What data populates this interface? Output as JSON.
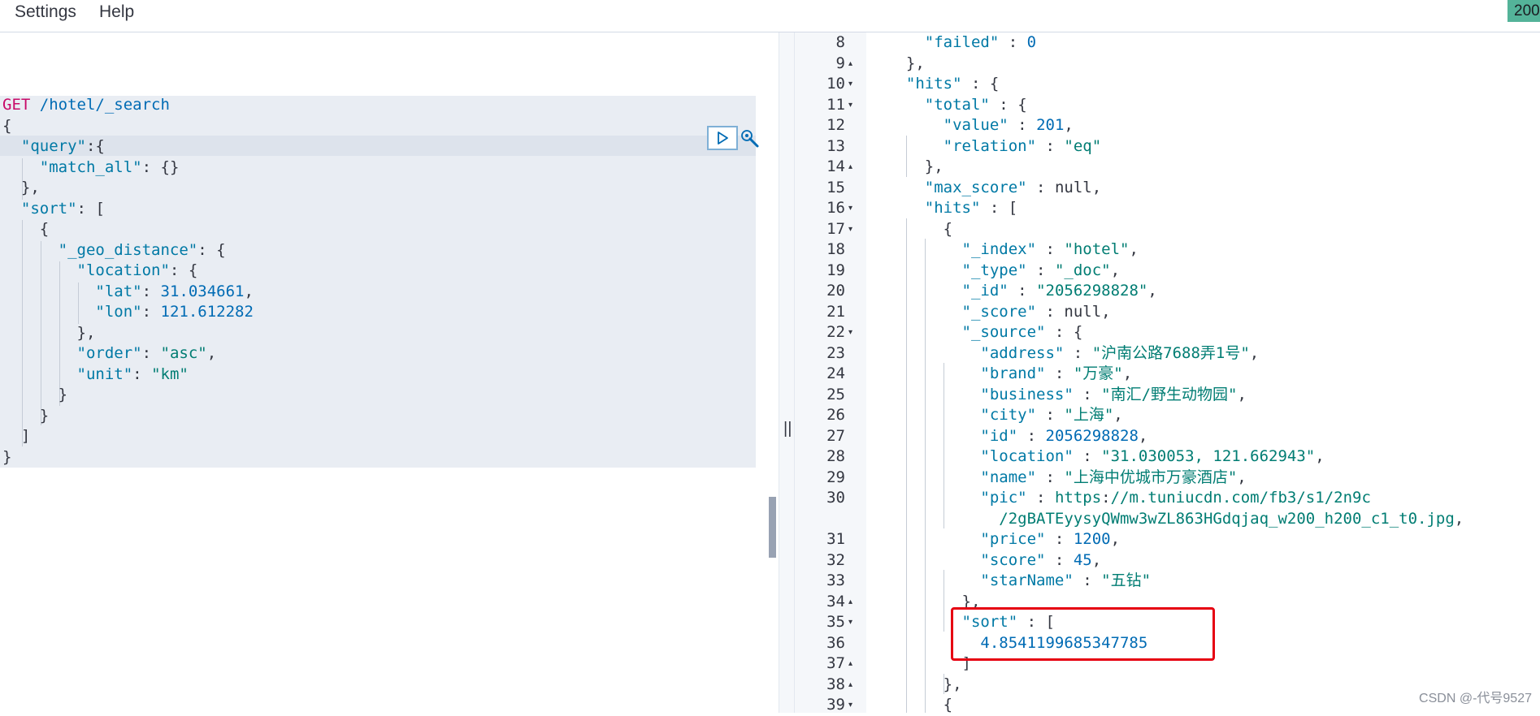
{
  "menu": {
    "settings_label": "Settings",
    "help_label": "Help"
  },
  "status_badge": "200",
  "request": {
    "method": "GET",
    "path": "/hotel/_search",
    "lines": [
      "{",
      "  \"query\":{",
      "    \"match_all\": {}",
      "  },",
      "  \"sort\": [",
      "    {",
      "      \"_geo_distance\": {",
      "        \"location\": {",
      "          \"lat\": 31.034661,",
      "          \"lon\": 121.612282",
      "        },",
      "        \"order\": \"asc\",",
      "        \"unit\": \"km\"",
      "      }",
      "    }",
      "  ]",
      "}"
    ]
  },
  "response": {
    "line_numbers": [
      "8",
      "9",
      "10",
      "11",
      "12",
      "13",
      "14",
      "15",
      "16",
      "17",
      "18",
      "19",
      "20",
      "21",
      "22",
      "23",
      "24",
      "25",
      "26",
      "27",
      "28",
      "29",
      "30",
      "",
      "31",
      "32",
      "33",
      "34",
      "35",
      "36",
      "37",
      "38",
      "39"
    ],
    "lines": [
      "    \"failed\" : 0",
      "  },",
      "  \"hits\" : {",
      "    \"total\" : {",
      "      \"value\" : 201,",
      "      \"relation\" : \"eq\"",
      "    },",
      "    \"max_score\" : null,",
      "    \"hits\" : [",
      "      {",
      "        \"_index\" : \"hotel\",",
      "        \"_type\" : \"_doc\",",
      "        \"_id\" : \"2056298828\",",
      "        \"_score\" : null,",
      "        \"_source\" : {",
      "          \"address\" : \"沪南公路7688弄1号\",",
      "          \"brand\" : \"万豪\",",
      "          \"business\" : \"南汇/野生动物园\",",
      "          \"city\" : \"上海\",",
      "          \"id\" : 2056298828,",
      "          \"location\" : \"31.030053, 121.662943\",",
      "          \"name\" : \"上海中优城市万豪酒店\",",
      "          \"pic\" : \"https://m.tuniucdn.com/fb3/s1/2n9c",
      "            /2gBATEyysyQWmw3wZL863HGdqjaq_w200_h200_c1_t0.jpg\",",
      "          \"price\" : 1200,",
      "          \"score\" : 45,",
      "          \"starName\" : \"五钻\"",
      "        },",
      "        \"sort\" : [",
      "          4.8541199685347785",
      "        ]",
      "      },",
      "      {"
    ],
    "folds": [
      "",
      "▴",
      "▾",
      "▾",
      "",
      "",
      "▴",
      "",
      "▾",
      "▾",
      "",
      "",
      "",
      "",
      "▾",
      "",
      "",
      "",
      "",
      "",
      "",
      "",
      "",
      "",
      "",
      "",
      "",
      "▴",
      "▾",
      "",
      "▴",
      "▴",
      "▾"
    ]
  },
  "splitter_glyph": "||",
  "watermark": "CSDN @-代号9527",
  "colors": {
    "highlight_box": "#e60012",
    "status_badge": "#54b399"
  }
}
